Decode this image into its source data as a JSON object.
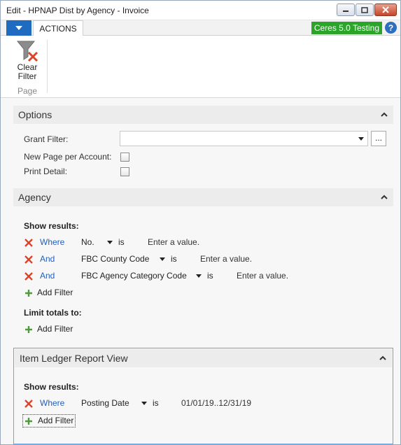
{
  "window": {
    "title": "Edit - HPNAP Dist by Agency - Invoice"
  },
  "ribbon": {
    "tab_actions": "ACTIONS",
    "company_badge": "Ceres 5.0 Testing",
    "help_glyph": "?",
    "clear_filter_label_line1": "Clear",
    "clear_filter_label_line2": "Filter",
    "group_page_label": "Page"
  },
  "options": {
    "header": "Options",
    "grant_filter_label": "Grant Filter:",
    "grant_filter_value": "",
    "lookup_label": "...",
    "new_page_label": "New Page per Account:",
    "print_detail_label": "Print Detail:",
    "new_page_checked": false,
    "print_detail_checked": false
  },
  "agency": {
    "header": "Agency",
    "show_results": "Show results:",
    "filters": [
      {
        "conj": "Where",
        "field": "No.",
        "op": "is",
        "value": "Enter a value."
      },
      {
        "conj": "And",
        "field": "FBC County Code",
        "op": "is",
        "value": "Enter a value."
      },
      {
        "conj": "And",
        "field": "FBC Agency Category Code",
        "op": "is",
        "value": "Enter a value."
      }
    ],
    "add_filter": "Add Filter",
    "limit_totals": "Limit totals to:",
    "add_filter_2": "Add Filter"
  },
  "item_ledger": {
    "header": "Item Ledger Report View",
    "show_results": "Show results:",
    "filters": [
      {
        "conj": "Where",
        "field": "Posting Date",
        "op": "is",
        "value": "01/01/19..12/31/19"
      }
    ],
    "add_filter": "Add Filter"
  },
  "colors": {
    "accent": "#1f6bc2",
    "badge": "#2aa52a",
    "remove": "#d9452b",
    "add": "#4e9a3c",
    "link": "#1f5fbf"
  }
}
